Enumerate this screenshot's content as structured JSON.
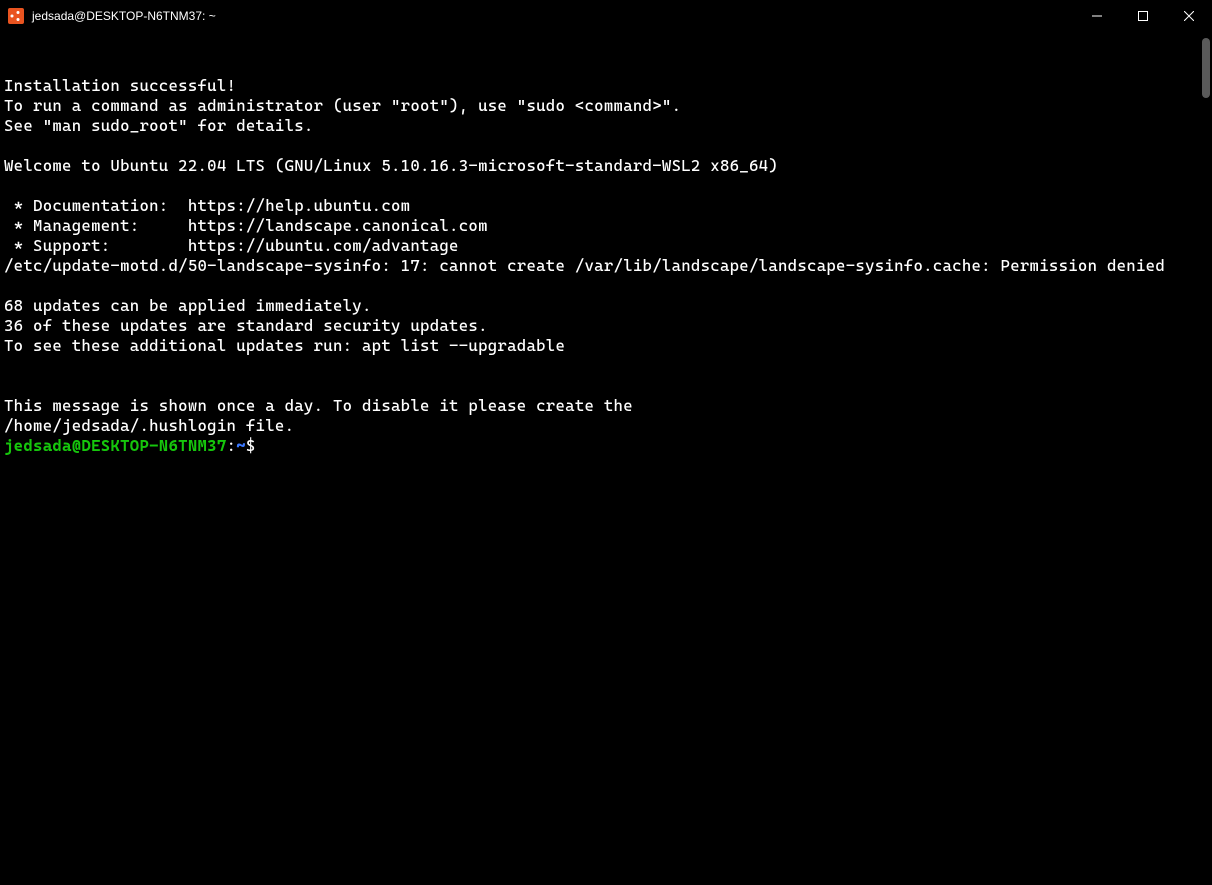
{
  "window": {
    "title": "jedsada@DESKTOP-N6TNM37: ~"
  },
  "terminal": {
    "lines": [
      "Installation successful!",
      "To run a command as administrator (user \"root\"), use \"sudo <command>\".",
      "See \"man sudo_root\" for details.",
      "",
      "Welcome to Ubuntu 22.04 LTS (GNU/Linux 5.10.16.3-microsoft-standard-WSL2 x86_64)",
      "",
      " * Documentation:  https://help.ubuntu.com",
      " * Management:     https://landscape.canonical.com",
      " * Support:        https://ubuntu.com/advantage",
      "/etc/update-motd.d/50-landscape-sysinfo: 17: cannot create /var/lib/landscape/landscape-sysinfo.cache: Permission denied",
      "",
      "68 updates can be applied immediately.",
      "36 of these updates are standard security updates.",
      "To see these additional updates run: apt list --upgradable",
      "",
      "",
      "This message is shown once a day. To disable it please create the",
      "/home/jedsada/.hushlogin file."
    ],
    "prompt": {
      "user_host": "jedsada@DESKTOP-N6TNM37",
      "colon": ":",
      "path": "~",
      "symbol": "$"
    }
  }
}
